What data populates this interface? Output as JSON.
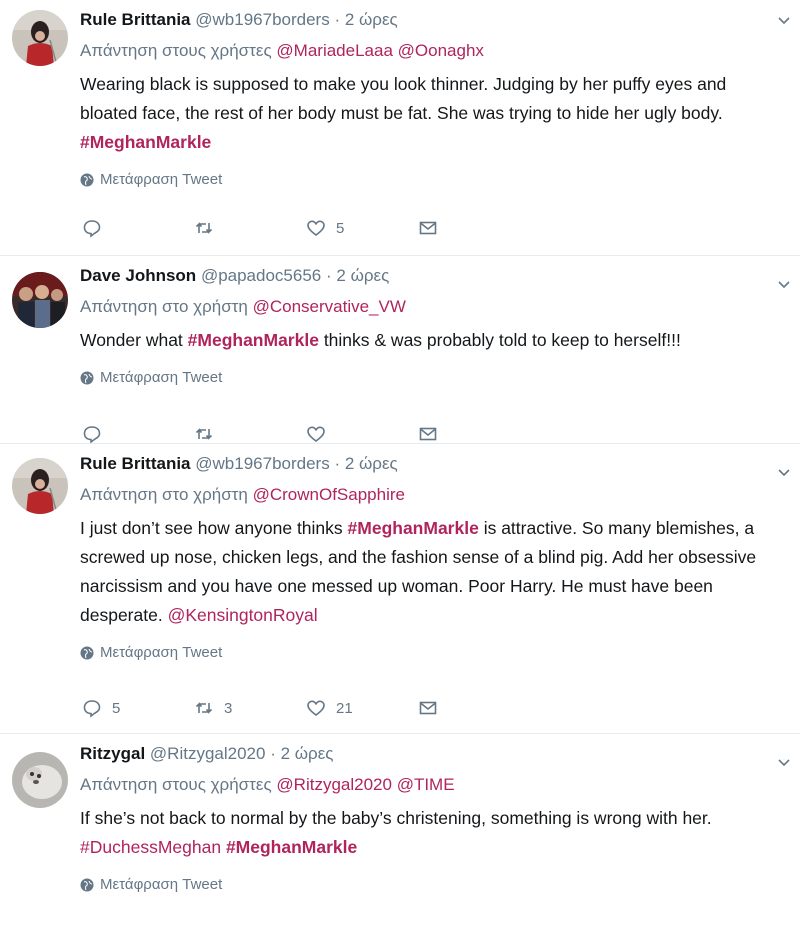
{
  "tweets": [
    {
      "name": "Rule Brittania",
      "handle": "@wb1967borders",
      "time": "2 ώρες",
      "reply_prefix": "Απάντηση στους χρήστες",
      "reply_mentions": [
        "@MariadeLaaa",
        "@Oonaghx"
      ],
      "text_parts": [
        "Wearing black is supposed to make you look thinner. Judging by her puffy eyes and bloated face, the rest of her body must be fat. She was trying to hide her ugly body. "
      ],
      "hashtag": "#MeghanMarkle",
      "translate": "Μετάφραση Tweet",
      "replies": "",
      "retweets": "",
      "likes": "5"
    },
    {
      "name": "Dave Johnson",
      "handle": "@papadoc5656",
      "time": "2 ώρες",
      "reply_prefix": "Απάντηση στο χρήστη",
      "reply_mentions": [
        "@Conservative_VW"
      ],
      "text_before": "Wonder what ",
      "hashtag": "#MeghanMarkle",
      "text_after": " thinks & was probably told to keep to herself!!!",
      "translate": "Μετάφραση Tweet",
      "replies": "",
      "retweets": "",
      "likes": ""
    },
    {
      "name": "Rule Brittania",
      "handle": "@wb1967borders",
      "time": "2 ώρες",
      "reply_prefix": "Απάντηση στο χρήστη",
      "reply_mentions": [
        "@CrownOfSapphire"
      ],
      "text_before": "I just don’t see how anyone thinks ",
      "hashtag": "#MeghanMarkle",
      "text_after": " is attractive. So many blemishes, a screwed up nose, chicken legs, and the fashion sense of a blind pig. Add her obsessive narcissism and you have one messed up woman. Poor Harry. He must have been desperate. ",
      "mention_end": "@KensingtonRoyal",
      "translate": "Μετάφραση Tweet",
      "replies": "5",
      "retweets": "3",
      "likes": "21"
    },
    {
      "name": "Ritzygal",
      "handle": "@Ritzygal2020",
      "time": "2 ώρες",
      "reply_prefix": "Απάντηση στους χρήστες",
      "reply_mentions": [
        "@Ritzygal2020",
        "@TIME"
      ],
      "text_before": "If she’s not back to normal by the baby’s christening, something is wrong with her. ",
      "hashtag_plain": "#DuchessMeghan",
      "hashtag": "#MeghanMarkle",
      "translate": "Μετάφραση Tweet"
    }
  ],
  "separator": "·",
  "colors": {
    "accent": "#b0245e",
    "muted": "#657786",
    "text": "#14171a"
  },
  "icons": [
    "reply-icon",
    "retweet-icon",
    "like-icon",
    "message-icon",
    "globe-icon",
    "chevron-down-icon"
  ]
}
